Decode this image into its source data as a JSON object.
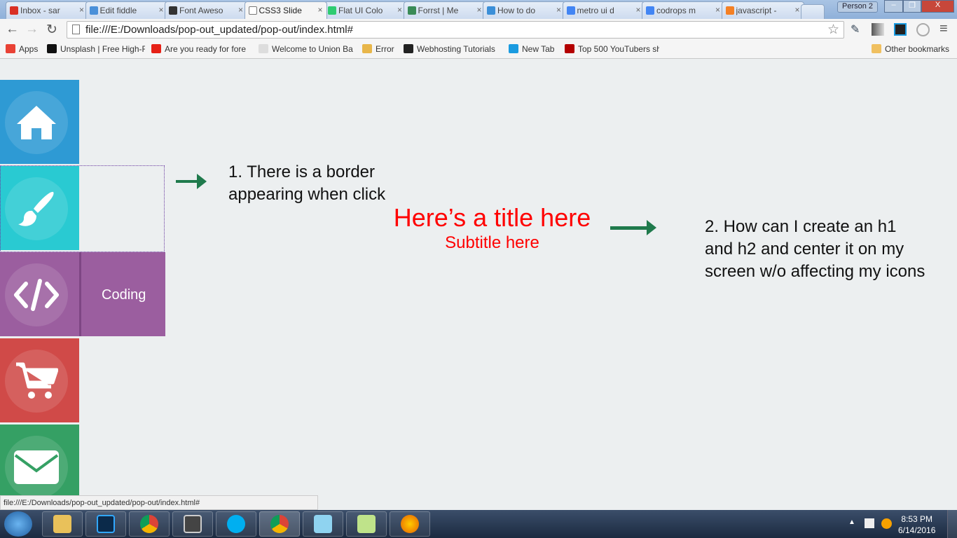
{
  "browser": {
    "tabs": [
      {
        "label": "Inbox - sar",
        "color": "#d93025"
      },
      {
        "label": "Edit fiddle",
        "color": "#4a90d9"
      },
      {
        "label": "Font Aweso",
        "color": "#333333"
      },
      {
        "label": "CSS3 Slide",
        "color": "#ffffff",
        "active": true
      },
      {
        "label": "Flat UI Colo",
        "color": "#2ecc71"
      },
      {
        "label": "Forrst | Me",
        "color": "#3a8b57"
      },
      {
        "label": "How to do",
        "color": "#3b8fd8"
      },
      {
        "label": "metro ui d",
        "color": "#4285f4"
      },
      {
        "label": "codrops m",
        "color": "#4285f4"
      },
      {
        "label": "javascript -",
        "color": "#f48024"
      }
    ],
    "close_glyph": "×",
    "profile": "Person 2",
    "url": "file:///E:/Downloads/pop-out_updated/pop-out/index.html#",
    "bookmarks": [
      {
        "label": "Apps",
        "color": "#e94235"
      },
      {
        "label": "Unsplash | Free High-R",
        "color": "#111111"
      },
      {
        "label": "Are you ready for fore",
        "color": "#e62117"
      },
      {
        "label": "Welcome to Union Ba",
        "color": "#dddddd"
      },
      {
        "label": "Error",
        "color": "#e8b64a"
      },
      {
        "label": "Webhosting Tutorials",
        "color": "#222222"
      },
      {
        "label": "New Tab",
        "color": "#1a9be0"
      },
      {
        "label": "Top 500 YouTubers sh",
        "color": "#b40000"
      }
    ],
    "other_bookmarks": "Other bookmarks",
    "status_url": "file:///E:/Downloads/pop-out_updated/pop-out/index.html#"
  },
  "sidebar": {
    "items": [
      {
        "icon": "home-icon",
        "color": "#2e9ad4"
      },
      {
        "icon": "paintbrush-icon",
        "color": "#29cad2"
      },
      {
        "icon": "code-icon",
        "color": "#9b5e9f",
        "label": "Coding"
      },
      {
        "icon": "cart-icon",
        "color": "#d04a48"
      },
      {
        "icon": "envelope-icon",
        "color": "#35a064"
      }
    ]
  },
  "main": {
    "title": "Here’s a title here",
    "subtitle": "Subtitle here",
    "note1": "1. There is a border appearing when click",
    "note2": "2. How can I create an h1 and h2 and center it on my screen w/o affecting my icons",
    "accent": "#ff0000",
    "arrow_color": "#1f7a4c"
  },
  "taskbar": {
    "time": "8:53 PM",
    "date": "6/14/2016"
  }
}
